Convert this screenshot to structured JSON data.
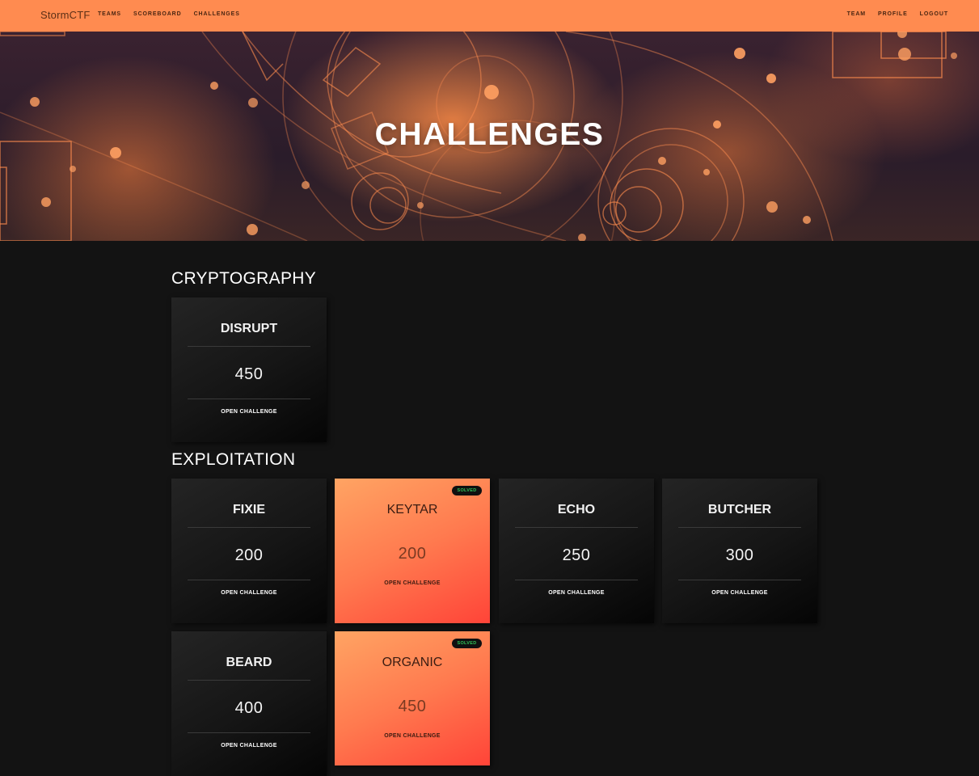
{
  "navbar": {
    "brand": "StormCTF",
    "left_links": [
      "TEAMS",
      "SCOREBOARD",
      "CHALLENGES"
    ],
    "right_links": [
      "TEAM",
      "PROFILE",
      "LOGOUT"
    ],
    "background_color": "#ff8b50"
  },
  "hero": {
    "title": "CHALLENGES"
  },
  "categories": [
    {
      "name": "CRYPTOGRAPHY",
      "challenges": [
        {
          "name": "DISRUPT",
          "points": "450",
          "action": "OPEN CHALLENGE",
          "solved": false
        }
      ]
    },
    {
      "name": "EXPLOITATION",
      "challenges": [
        {
          "name": "FIXIE",
          "points": "200",
          "action": "OPEN CHALLENGE",
          "solved": false
        },
        {
          "name": "KEYTAR",
          "points": "200",
          "action": "OPEN CHALLENGE",
          "solved": true,
          "badge": "SOLVED"
        },
        {
          "name": "ECHO",
          "points": "250",
          "action": "OPEN CHALLENGE",
          "solved": false
        },
        {
          "name": "BUTCHER",
          "points": "300",
          "action": "OPEN CHALLENGE",
          "solved": false
        },
        {
          "name": "BEARD",
          "points": "400",
          "action": "OPEN CHALLENGE",
          "solved": false
        },
        {
          "name": "ORGANIC",
          "points": "450",
          "action": "OPEN CHALLENGE",
          "solved": true,
          "badge": "SOLVED"
        }
      ]
    }
  ],
  "colors": {
    "accent": "#ff8b50",
    "solved_gradient_start": "#ffa463",
    "solved_gradient_end": "#ff4438",
    "solved_badge_text": "#31c45a",
    "page_background": "#131313"
  }
}
